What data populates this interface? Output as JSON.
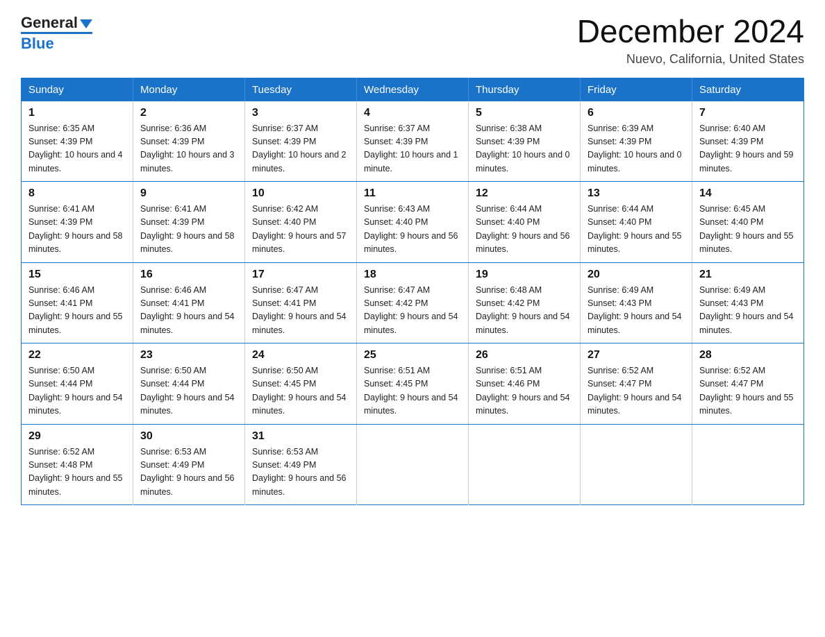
{
  "header": {
    "logo_top": "General",
    "logo_bottom": "Blue",
    "month_title": "December 2024",
    "location": "Nuevo, California, United States"
  },
  "days_of_week": [
    "Sunday",
    "Monday",
    "Tuesday",
    "Wednesday",
    "Thursday",
    "Friday",
    "Saturday"
  ],
  "weeks": [
    [
      {
        "day": "1",
        "sunrise": "6:35 AM",
        "sunset": "4:39 PM",
        "daylight": "10 hours and 4 minutes."
      },
      {
        "day": "2",
        "sunrise": "6:36 AM",
        "sunset": "4:39 PM",
        "daylight": "10 hours and 3 minutes."
      },
      {
        "day": "3",
        "sunrise": "6:37 AM",
        "sunset": "4:39 PM",
        "daylight": "10 hours and 2 minutes."
      },
      {
        "day": "4",
        "sunrise": "6:37 AM",
        "sunset": "4:39 PM",
        "daylight": "10 hours and 1 minute."
      },
      {
        "day": "5",
        "sunrise": "6:38 AM",
        "sunset": "4:39 PM",
        "daylight": "10 hours and 0 minutes."
      },
      {
        "day": "6",
        "sunrise": "6:39 AM",
        "sunset": "4:39 PM",
        "daylight": "10 hours and 0 minutes."
      },
      {
        "day": "7",
        "sunrise": "6:40 AM",
        "sunset": "4:39 PM",
        "daylight": "9 hours and 59 minutes."
      }
    ],
    [
      {
        "day": "8",
        "sunrise": "6:41 AM",
        "sunset": "4:39 PM",
        "daylight": "9 hours and 58 minutes."
      },
      {
        "day": "9",
        "sunrise": "6:41 AM",
        "sunset": "4:39 PM",
        "daylight": "9 hours and 58 minutes."
      },
      {
        "day": "10",
        "sunrise": "6:42 AM",
        "sunset": "4:40 PM",
        "daylight": "9 hours and 57 minutes."
      },
      {
        "day": "11",
        "sunrise": "6:43 AM",
        "sunset": "4:40 PM",
        "daylight": "9 hours and 56 minutes."
      },
      {
        "day": "12",
        "sunrise": "6:44 AM",
        "sunset": "4:40 PM",
        "daylight": "9 hours and 56 minutes."
      },
      {
        "day": "13",
        "sunrise": "6:44 AM",
        "sunset": "4:40 PM",
        "daylight": "9 hours and 55 minutes."
      },
      {
        "day": "14",
        "sunrise": "6:45 AM",
        "sunset": "4:40 PM",
        "daylight": "9 hours and 55 minutes."
      }
    ],
    [
      {
        "day": "15",
        "sunrise": "6:46 AM",
        "sunset": "4:41 PM",
        "daylight": "9 hours and 55 minutes."
      },
      {
        "day": "16",
        "sunrise": "6:46 AM",
        "sunset": "4:41 PM",
        "daylight": "9 hours and 54 minutes."
      },
      {
        "day": "17",
        "sunrise": "6:47 AM",
        "sunset": "4:41 PM",
        "daylight": "9 hours and 54 minutes."
      },
      {
        "day": "18",
        "sunrise": "6:47 AM",
        "sunset": "4:42 PM",
        "daylight": "9 hours and 54 minutes."
      },
      {
        "day": "19",
        "sunrise": "6:48 AM",
        "sunset": "4:42 PM",
        "daylight": "9 hours and 54 minutes."
      },
      {
        "day": "20",
        "sunrise": "6:49 AM",
        "sunset": "4:43 PM",
        "daylight": "9 hours and 54 minutes."
      },
      {
        "day": "21",
        "sunrise": "6:49 AM",
        "sunset": "4:43 PM",
        "daylight": "9 hours and 54 minutes."
      }
    ],
    [
      {
        "day": "22",
        "sunrise": "6:50 AM",
        "sunset": "4:44 PM",
        "daylight": "9 hours and 54 minutes."
      },
      {
        "day": "23",
        "sunrise": "6:50 AM",
        "sunset": "4:44 PM",
        "daylight": "9 hours and 54 minutes."
      },
      {
        "day": "24",
        "sunrise": "6:50 AM",
        "sunset": "4:45 PM",
        "daylight": "9 hours and 54 minutes."
      },
      {
        "day": "25",
        "sunrise": "6:51 AM",
        "sunset": "4:45 PM",
        "daylight": "9 hours and 54 minutes."
      },
      {
        "day": "26",
        "sunrise": "6:51 AM",
        "sunset": "4:46 PM",
        "daylight": "9 hours and 54 minutes."
      },
      {
        "day": "27",
        "sunrise": "6:52 AM",
        "sunset": "4:47 PM",
        "daylight": "9 hours and 54 minutes."
      },
      {
        "day": "28",
        "sunrise": "6:52 AM",
        "sunset": "4:47 PM",
        "daylight": "9 hours and 55 minutes."
      }
    ],
    [
      {
        "day": "29",
        "sunrise": "6:52 AM",
        "sunset": "4:48 PM",
        "daylight": "9 hours and 55 minutes."
      },
      {
        "day": "30",
        "sunrise": "6:53 AM",
        "sunset": "4:49 PM",
        "daylight": "9 hours and 56 minutes."
      },
      {
        "day": "31",
        "sunrise": "6:53 AM",
        "sunset": "4:49 PM",
        "daylight": "9 hours and 56 minutes."
      },
      null,
      null,
      null,
      null
    ]
  ]
}
